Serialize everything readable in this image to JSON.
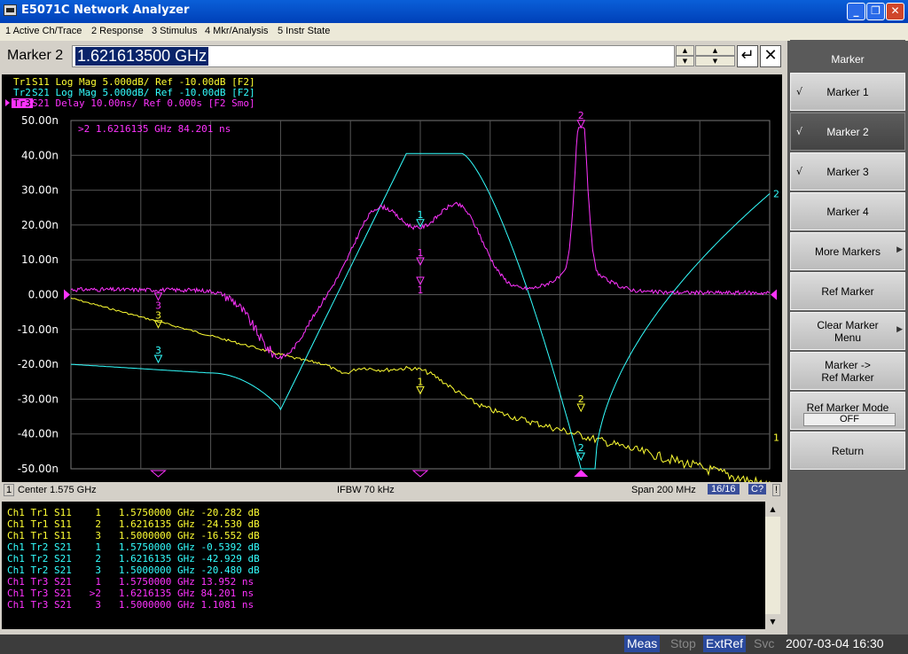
{
  "window": {
    "title": "E5071C Network Analyzer",
    "minimize_glyph": "_",
    "restore_glyph": "❐",
    "close_glyph": "✕"
  },
  "menu": [
    "1 Active Ch/Trace",
    "2 Response",
    "3 Stimulus",
    "4 Mkr/Analysis",
    "5 Instr State"
  ],
  "entry": {
    "label": "Marker 2",
    "value": "1.621613500 GHz",
    "up_glyph": "▲",
    "down_glyph": "▼",
    "enter_glyph": "↵",
    "cancel_glyph": "✕"
  },
  "traces": {
    "header": [
      {
        "tag": "Tr1",
        "text": " S11 Log Mag 5.000dB/ Ref -10.00dB [F2]",
        "color": "#ffff33"
      },
      {
        "tag": "Tr2",
        "text": " S21 Log Mag 5.000dB/ Ref -10.00dB [F2]",
        "color": "#33ffff"
      },
      {
        "tag": "Tr3",
        "text": " S21 Delay 10.00ns/ Ref 0.000s [F2 Smo]",
        "color": "#ff33ff"
      }
    ],
    "active_marker_readout": ">2   1.6216135 GHz   84.201 ns",
    "y_ticks": [
      "50.00n",
      "40.00n",
      "30.00n",
      "20.00n",
      "10.00n",
      "0.000",
      "-10.00n",
      "-20.00n",
      "-30.00n",
      "-40.00n",
      "-50.00n"
    ]
  },
  "status": {
    "channel": "1",
    "center": "Center 1.575 GHz",
    "ifbw": "IFBW 70 kHz",
    "span": "Span 200 MHz",
    "points": "16/16",
    "cal": "C?",
    "excl": "!"
  },
  "marker_table": [
    {
      "ch": "Ch1",
      "tr": "Tr1",
      "param": "S11",
      "mkr": "1",
      "freq": "1.5750000 GHz",
      "val": "-20.282 dB",
      "color": "#ffff33"
    },
    {
      "ch": "Ch1",
      "tr": "Tr1",
      "param": "S11",
      "mkr": "2",
      "freq": "1.6216135 GHz",
      "val": "-24.530 dB",
      "color": "#ffff33"
    },
    {
      "ch": "Ch1",
      "tr": "Tr1",
      "param": "S11",
      "mkr": "3",
      "freq": "1.5000000 GHz",
      "val": "-16.552 dB",
      "color": "#ffff33"
    },
    {
      "ch": "Ch1",
      "tr": "Tr2",
      "param": "S21",
      "mkr": "1",
      "freq": "1.5750000 GHz",
      "val": "-0.5392 dB",
      "color": "#33ffff"
    },
    {
      "ch": "Ch1",
      "tr": "Tr2",
      "param": "S21",
      "mkr": "2",
      "freq": "1.6216135 GHz",
      "val": "-42.929 dB",
      "color": "#33ffff"
    },
    {
      "ch": "Ch1",
      "tr": "Tr2",
      "param": "S21",
      "mkr": "3",
      "freq": "1.5000000 GHz",
      "val": "-20.480 dB",
      "color": "#33ffff"
    },
    {
      "ch": "Ch1",
      "tr": "Tr3",
      "param": "S21",
      "mkr": "1",
      "freq": "1.5750000 GHz",
      "val": "13.952 ns",
      "color": "#ff33ff"
    },
    {
      "ch": "Ch1",
      "tr": "Tr3",
      "param": "S21",
      "mkr": ">2",
      "freq": "1.6216135 GHz",
      "val": "84.201 ns",
      "color": "#ff33ff"
    },
    {
      "ch": "Ch1",
      "tr": "Tr3",
      "param": "S21",
      "mkr": "3",
      "freq": "1.5000000 GHz",
      "val": "1.1081 ns",
      "color": "#ff33ff"
    }
  ],
  "softkeys": {
    "header": "Marker",
    "items": [
      {
        "label": "Marker 1",
        "check": "√",
        "active": false,
        "arrow": ""
      },
      {
        "label": "Marker 2",
        "check": "√",
        "active": true,
        "arrow": ""
      },
      {
        "label": "Marker 3",
        "check": "√",
        "active": false,
        "arrow": ""
      },
      {
        "label": "Marker 4",
        "check": "",
        "active": false,
        "arrow": ""
      },
      {
        "label": "More Markers",
        "check": "",
        "active": false,
        "arrow": "▶"
      },
      {
        "label": "Ref Marker",
        "check": "",
        "active": false,
        "arrow": ""
      },
      {
        "label": "Clear Marker\nMenu",
        "check": "",
        "active": false,
        "arrow": "▶"
      },
      {
        "label": "Marker ->\nRef Marker",
        "check": "",
        "active": false,
        "arrow": ""
      },
      {
        "label": "Ref Marker Mode",
        "check": "",
        "active": false,
        "arrow": "",
        "value": "OFF"
      },
      {
        "label": "Return",
        "check": "",
        "active": false,
        "arrow": ""
      }
    ]
  },
  "bottom": {
    "meas": "Meas",
    "stop": "Stop",
    "extref": "ExtRef",
    "svc": "Svc",
    "datetime": "2007-03-04 16:30"
  },
  "colors": {
    "tr1": "#ffff33",
    "tr2": "#33ffff",
    "tr3": "#ff33ff",
    "title_blue": "#0a5fd8",
    "active_key": "#4a4a4a"
  }
}
